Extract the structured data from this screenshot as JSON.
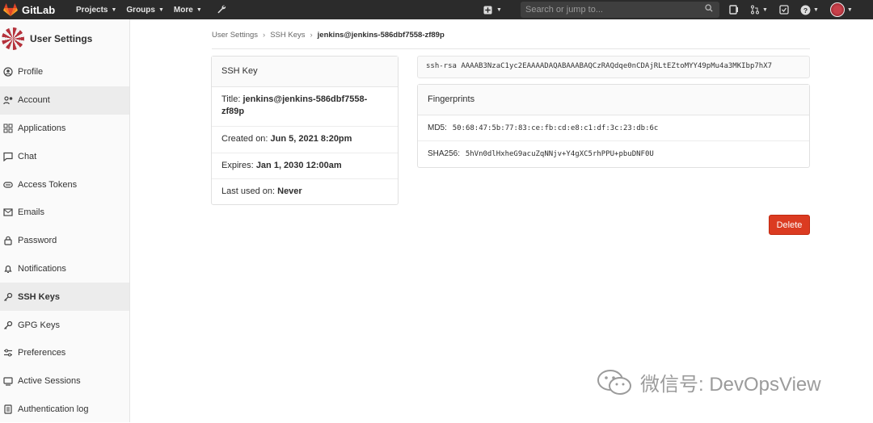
{
  "navbar": {
    "brand": "GitLab",
    "menu": [
      {
        "label": "Projects"
      },
      {
        "label": "Groups"
      },
      {
        "label": "More"
      }
    ],
    "search_placeholder": "Search or jump to..."
  },
  "sidebar": {
    "title": "User Settings",
    "items": [
      {
        "label": "Profile",
        "icon": "profile-icon",
        "active": false
      },
      {
        "label": "Account",
        "icon": "account-icon",
        "active": true
      },
      {
        "label": "Applications",
        "icon": "applications-icon",
        "active": false
      },
      {
        "label": "Chat",
        "icon": "chat-icon",
        "active": false
      },
      {
        "label": "Access Tokens",
        "icon": "token-icon",
        "active": false
      },
      {
        "label": "Emails",
        "icon": "email-icon",
        "active": false
      },
      {
        "label": "Password",
        "icon": "lock-icon",
        "active": false
      },
      {
        "label": "Notifications",
        "icon": "bell-icon",
        "active": false
      },
      {
        "label": "SSH Keys",
        "icon": "key-icon",
        "active": true
      },
      {
        "label": "GPG Keys",
        "icon": "key-icon",
        "active": false
      },
      {
        "label": "Preferences",
        "icon": "preferences-icon",
        "active": false
      },
      {
        "label": "Active Sessions",
        "icon": "sessions-icon",
        "active": false
      },
      {
        "label": "Authentication log",
        "icon": "log-icon",
        "active": false
      }
    ]
  },
  "breadcrumb": {
    "items": [
      "User Settings",
      "SSH Keys"
    ],
    "current": "jenkins@jenkins-586dbf7558-zf89p"
  },
  "key_card": {
    "header": "SSH Key",
    "title_label": "Title:",
    "title_value": "jenkins@jenkins-586dbf7558-zf89p",
    "created_label": "Created on:",
    "created_value": "Jun 5, 2021 8:20pm",
    "expires_label": "Expires:",
    "expires_value": "Jan 1, 2030 12:00am",
    "last_used_label": "Last used on:",
    "last_used_value": "Never"
  },
  "ssh_key_text": "ssh-rsa AAAAB3NzaC1yc2EAAAADAQABAAABAQCzRAQdqe0nCDAjRLtEZtoMYY49pMu4a3MKIbp7hX7",
  "fingerprints": {
    "header": "Fingerprints",
    "md5_label": "MD5:",
    "md5_value": "50:68:47:5b:77:83:ce:fb:cd:e8:c1:df:3c:23:db:6c",
    "sha256_label": "SHA256:",
    "sha256_value": "5hVn0dlHxheG9acuZqNNjv+Y4gXC5rhPPU+pbuDNF0U"
  },
  "delete_label": "Delete",
  "watermark": "微信号: DevOpsView",
  "colors": {
    "navbar": "#2b2b2b",
    "delete": "#db3b21",
    "gitlab_orange": "#e24329"
  }
}
